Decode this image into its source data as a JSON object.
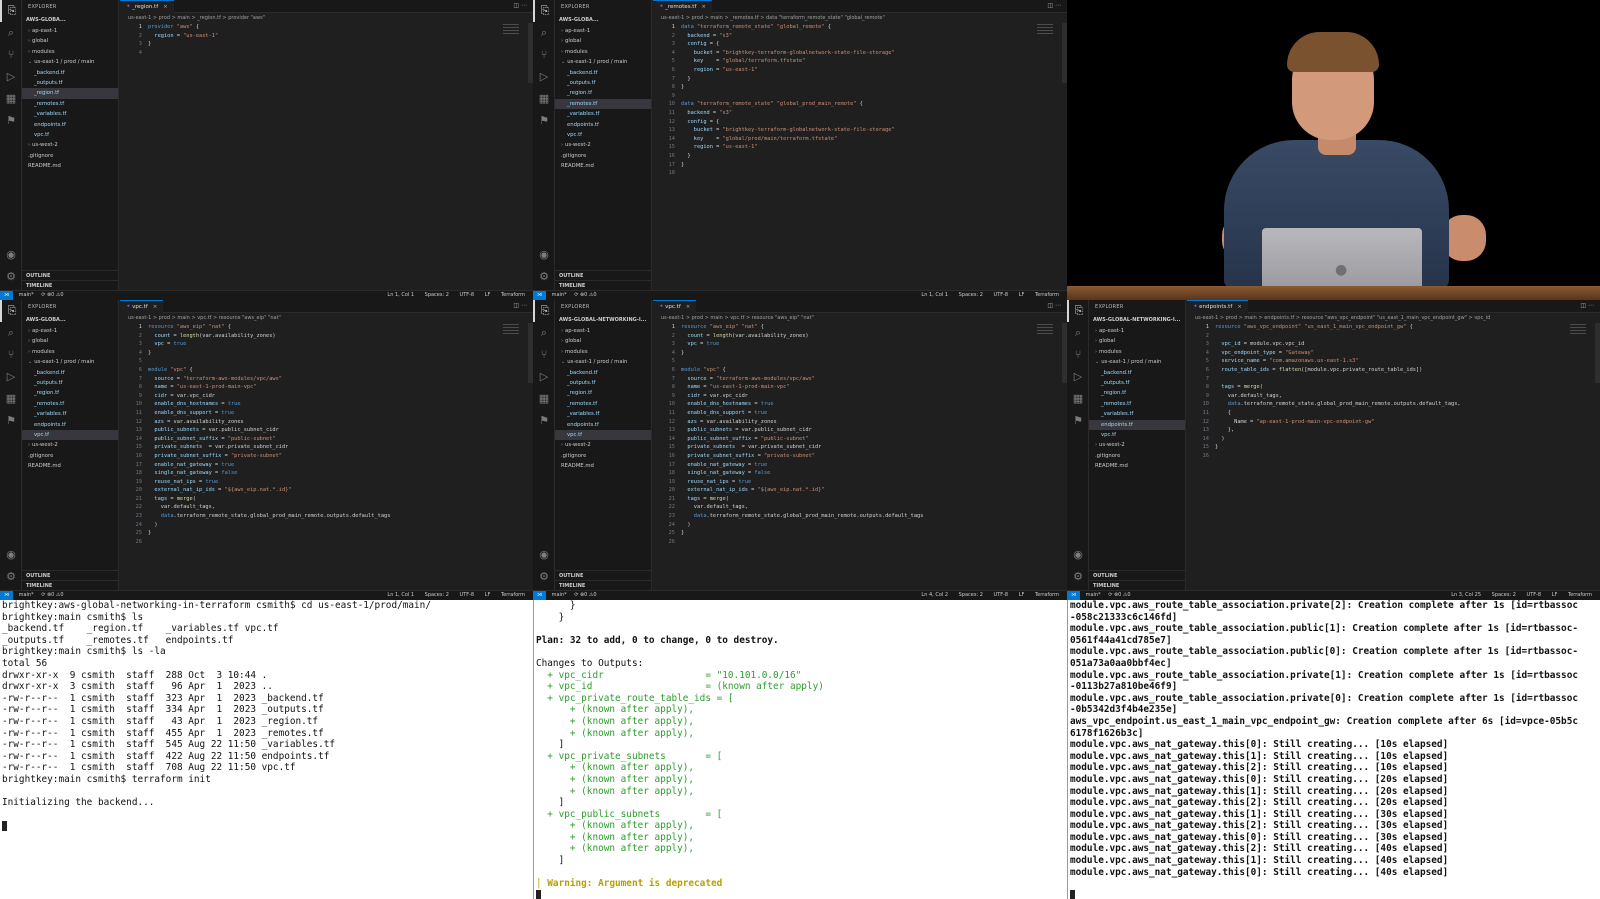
{
  "common": {
    "explorer_title": "EXPLORER",
    "outline": "OUTLINE",
    "timeline": "TIMELINE",
    "branch": "main*",
    "sync": "⟳ ⊗0 ⚠0",
    "spaces": "Spaces: 2",
    "encoding": "UTF-8",
    "eol": "LF",
    "language": "Terraform"
  },
  "panes": [
    {
      "root": "AWS-GLOBA...",
      "tab": "_region.tf",
      "breadcrumb": "us-east-1 > prod > main > _region.tf > provider \"aws\"",
      "cursor": "Ln 1, Col 1",
      "tree": [
        "ap-east-1",
        "global",
        "modules",
        "us-east-1 / prod / main",
        "_backend.tf",
        "_outputs.tf",
        "_region.tf",
        "_remotes.tf",
        "_variables.tf",
        "endpoints.tf",
        "vpc.tf",
        "us-west-2",
        ".gitignore",
        "README.md"
      ],
      "lines": [
        "provider \"aws\" {",
        "  region = \"us-east-1\"",
        "}",
        ""
      ]
    },
    {
      "root": "AWS-GLOBA...",
      "tab": "_remotes.tf",
      "breadcrumb": "us-east-1 > prod > main > _remotes.tf > data \"terraform_remote_state\" \"global_remote\"",
      "cursor": "Ln 1, Col 1",
      "tree": [
        "ap-east-1",
        "global",
        "modules",
        "us-east-1 / prod / main",
        "_backend.tf",
        "_outputs.tf",
        "_region.tf",
        "_remotes.tf",
        "_variables.tf",
        "endpoints.tf",
        "vpc.tf",
        "us-west-2",
        ".gitignore",
        "README.md"
      ],
      "lines": [
        "data \"terraform_remote_state\" \"global_remote\" {",
        "  backend = \"s3\"",
        "  config = {",
        "    bucket = \"brightkey-terraform-globalnetwork-state-file-storage\"",
        "    key    = \"global/terraform.tfstate\"",
        "    region = \"us-east-1\"",
        "  }",
        "}",
        "",
        "data \"terraform_remote_state\" \"global_prod_main_remote\" {",
        "  backend = \"s3\"",
        "  config = {",
        "    bucket = \"brightkey-terraform-globalnetwork-state-file-storage\"",
        "    key    = \"global/prod/main/terraform.tfstate\"",
        "    region = \"us-east-1\"",
        "  }",
        "}",
        ""
      ]
    },
    {
      "root": "AWS-GLOBA...",
      "tab": "vpc.tf",
      "breadcrumb": "us-east-1 > prod > main > vpc.tf > resource \"aws_eip\" \"nat\"",
      "cursor": "Ln 1, Col 1",
      "tree": [
        "ap-east-1",
        "global",
        "modules",
        "us-east-1 / prod / main",
        "_backend.tf",
        "_outputs.tf",
        "_region.tf",
        "_remotes.tf",
        "_variables.tf",
        "endpoints.tf",
        "vpc.tf",
        "us-west-2",
        ".gitignore",
        "README.md"
      ],
      "lines": [
        "resource \"aws_eip\" \"nat\" {",
        "  count = length(var.availability_zones)",
        "  vpc = true",
        "}",
        "",
        "module \"vpc\" {",
        "  source = \"terraform-aws-modules/vpc/aws\"",
        "  name = \"us-east-1-prod-main-vpc\"",
        "  cidr = var.vpc_cidr",
        "  enable_dns_hostnames = true",
        "  enable_dns_support = true",
        "  azs = var.availability_zones",
        "  public_subnets = var.public_subnet_cidr",
        "  public_subnet_suffix = \"public-subnet\"",
        "  private_subnets  = var.private_subnet_cidr",
        "  private_subnet_suffix = \"private-subnet\"",
        "  enable_nat_gateway = true",
        "  single_nat_gateway = false",
        "  reuse_nat_ips = true",
        "  external_nat_ip_ids = \"${aws_eip.nat.*.id}\"",
        "  tags = merge(",
        "    var.default_tags,",
        "    data.terraform_remote_state.global_prod_main_remote.outputs.default_tags",
        "  )",
        "}",
        ""
      ]
    },
    {
      "root": "AWS-GLOBAL-NETWORKING-I...",
      "tab": "vpc.tf",
      "breadcrumb": "us-east-1 > prod > main > vpc.tf > resource \"aws_eip\" \"nat\"",
      "cursor": "Ln 4, Col 2",
      "tree": [
        "ap-east-1",
        "global",
        "modules",
        "us-east-1 / prod / main",
        "_backend.tf",
        "_outputs.tf",
        "_region.tf",
        "_remotes.tf",
        "_variables.tf",
        "endpoints.tf",
        "vpc.tf",
        "us-west-2",
        ".gitignore",
        "README.md"
      ],
      "lines": [
        "resource \"aws_eip\" \"nat\" {",
        "  count = length(var.availability_zones)",
        "  vpc = true",
        "}",
        "",
        "module \"vpc\" {",
        "  source = \"terraform-aws-modules/vpc/aws\"",
        "  name = \"us-east-1-prod-main-vpc\"",
        "  cidr = var.vpc_cidr",
        "  enable_dns_hostnames = true",
        "  enable_dns_support = true",
        "  azs = var.availability_zones",
        "  public_subnets = var.public_subnet_cidr",
        "  public_subnet_suffix = \"public-subnet\"",
        "  private_subnets  = var.private_subnet_cidr",
        "  private_subnet_suffix = \"private-subnet\"",
        "  enable_nat_gateway = true",
        "  single_nat_gateway = false",
        "  reuse_nat_ips = true",
        "  external_nat_ip_ids = \"${aws_eip.nat.*.id}\"",
        "  tags = merge(",
        "    var.default_tags,",
        "    data.terraform_remote_state.global_prod_main_remote.outputs.default_tags",
        "  )",
        "}",
        ""
      ]
    },
    {
      "root": "AWS-GLOBAL-NETWORKING-I...",
      "tab": "endpoints.tf",
      "breadcrumb": "us-east-1 > prod > main > endpoints.tf > resource \"aws_vpc_endpoint\" \"us_east_1_main_vpc_endpoint_gw\" > vpc_id",
      "cursor": "Ln 3, Col 25",
      "tree": [
        "ap-east-1",
        "global",
        "modules",
        "us-east-1 / prod / main",
        "_backend.tf",
        "_outputs.tf",
        "_region.tf",
        "_remotes.tf",
        "_variables.tf",
        "endpoints.tf",
        "vpc.tf",
        "us-west-2",
        ".gitignore",
        "README.md"
      ],
      "lines": [
        "resource \"aws_vpc_endpoint\" \"us_east_1_main_vpc_endpoint_gw\" {",
        "",
        "  vpc_id = module.vpc.vpc_id",
        "  vpc_endpoint_type = \"Gateway\"",
        "  service_name = \"com.amazonaws.us-east-1.s3\"",
        "  route_table_ids = flatten([module.vpc.private_route_table_ids])",
        "",
        "  tags = merge(",
        "    var.default_tags,",
        "    data.terraform_remote_state.global_prod_main_remote.outputs.default_tags,",
        "    {",
        "      Name = \"ap-east-1-prod-main-vpc-endpoint-gw\"",
        "    },",
        "  )",
        "}",
        ""
      ]
    }
  ],
  "terminals": {
    "t1": [
      "brightkey:aws-global-networking-in-terraform csmith$ cd us-east-1/prod/main/",
      "brightkey:main csmith$ ls",
      "_backend.tf    _region.tf    _variables.tf vpc.tf",
      "_outputs.tf    _remotes.tf   endpoints.tf",
      "brightkey:main csmith$ ls -la",
      "total 56",
      "drwxr-xr-x  9 csmith  staff  288 Oct  3 10:44 .",
      "drwxr-xr-x  3 csmith  staff   96 Apr  1  2023 ..",
      "-rw-r--r--  1 csmith  staff  323 Apr  1  2023 _backend.tf",
      "-rw-r--r--  1 csmith  staff  334 Apr  1  2023 _outputs.tf",
      "-rw-r--r--  1 csmith  staff   43 Apr  1  2023 _region.tf",
      "-rw-r--r--  1 csmith  staff  455 Apr  1  2023 _remotes.tf",
      "-rw-r--r--  1 csmith  staff  545 Aug 22 11:50 _variables.tf",
      "-rw-r--r--  1 csmith  staff  422 Aug 22 11:50 endpoints.tf",
      "-rw-r--r--  1 csmith  staff  708 Aug 22 11:50 vpc.tf",
      "brightkey:main csmith$ terraform init",
      "",
      "Initializing the backend...",
      ""
    ],
    "t2": [
      "      }",
      "    }",
      "",
      "Plan: 32 to add, 0 to change, 0 to destroy.",
      "",
      "Changes to Outputs:",
      "  + vpc_cidr                  = \"10.101.0.0/16\"",
      "  + vpc_id                    = (known after apply)",
      "  + vpc_private_route_table_ids = [",
      "      + (known after apply),",
      "      + (known after apply),",
      "      + (known after apply),",
      "    ]",
      "  + vpc_private_subnets       = [",
      "      + (known after apply),",
      "      + (known after apply),",
      "      + (known after apply),",
      "    ]",
      "  + vpc_public_subnets        = [",
      "      + (known after apply),",
      "      + (known after apply),",
      "      + (known after apply),",
      "    ]",
      "",
      "│ Warning: Argument is deprecated"
    ],
    "t3": [
      "module.vpc.aws_route_table_association.private[2]: Creation complete after 1s [id=rtbassoc",
      "-058c21333c6c146fd]",
      "module.vpc.aws_route_table_association.public[1]: Creation complete after 1s [id=rtbassoc-",
      "0561f44a41cd785e7]",
      "module.vpc.aws_route_table_association.public[0]: Creation complete after 1s [id=rtbassoc-",
      "051a73a0aa0bbf4ec]",
      "module.vpc.aws_route_table_association.private[1]: Creation complete after 1s [id=rtbassoc",
      "-0113b27a810be46f9]",
      "module.vpc.aws_route_table_association.private[0]: Creation complete after 1s [id=rtbassoc",
      "-0b5342d3f4b4e235e]",
      "aws_vpc_endpoint.us_east_1_main_vpc_endpoint_gw: Creation complete after 6s [id=vpce-05b5c",
      "6178f1626b3c]",
      "module.vpc.aws_nat_gateway.this[0]: Still creating... [10s elapsed]",
      "module.vpc.aws_nat_gateway.this[1]: Still creating... [10s elapsed]",
      "module.vpc.aws_nat_gateway.this[2]: Still creating... [10s elapsed]",
      "module.vpc.aws_nat_gateway.this[0]: Still creating... [20s elapsed]",
      "module.vpc.aws_nat_gateway.this[1]: Still creating... [20s elapsed]",
      "module.vpc.aws_nat_gateway.this[2]: Still creating... [20s elapsed]",
      "module.vpc.aws_nat_gateway.this[1]: Still creating... [30s elapsed]",
      "module.vpc.aws_nat_gateway.this[2]: Still creating... [30s elapsed]",
      "module.vpc.aws_nat_gateway.this[0]: Still creating... [30s elapsed]",
      "module.vpc.aws_nat_gateway.this[2]: Still creating... [40s elapsed]",
      "module.vpc.aws_nat_gateway.this[1]: Still creating... [40s elapsed]",
      "module.vpc.aws_nat_gateway.this[0]: Still creating... [40s elapsed]",
      ""
    ]
  },
  "colors": {
    "accent": "#0078d4",
    "tf_file": "#9cdcfe",
    "warning": "#b8a000",
    "plus": "#2e9d2e"
  }
}
